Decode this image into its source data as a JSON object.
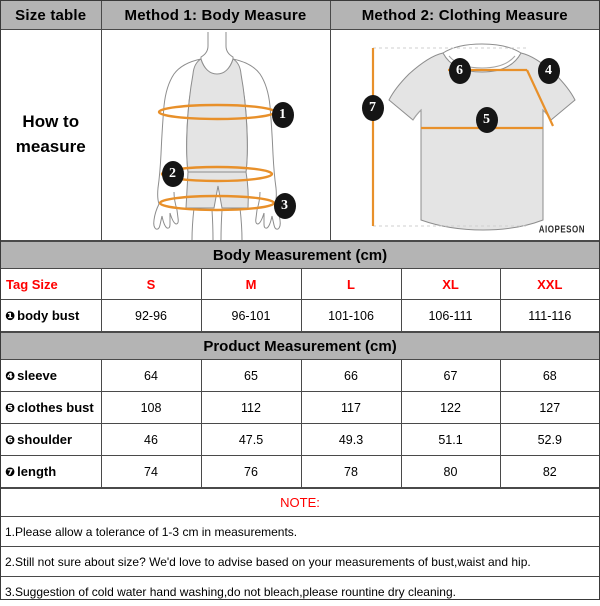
{
  "header": {
    "size_table": "Size table",
    "method1": "Method 1: Body  Measure",
    "method2": "Method 2: Clothing Measure"
  },
  "howto": {
    "line1": "How to",
    "line2": "measure"
  },
  "figures": {
    "body": {
      "callouts": [
        {
          "n": "1",
          "meaning": "body-bust"
        },
        {
          "n": "2",
          "meaning": "waist"
        },
        {
          "n": "3",
          "meaning": "hip"
        }
      ]
    },
    "clothing": {
      "callouts": [
        {
          "n": "4",
          "meaning": "sleeve"
        },
        {
          "n": "5",
          "meaning": "clothes-bust"
        },
        {
          "n": "6",
          "meaning": "shoulder"
        },
        {
          "n": "7",
          "meaning": "length"
        }
      ],
      "watermark": "AIOPESON"
    },
    "colors": {
      "measure_line": "#e8902a",
      "garment_fill": "#e4e4e4",
      "garment_stroke": "#8d8d8d",
      "callout_bg": "#151515"
    }
  },
  "body_section": {
    "title": "Body Measurement (cm)",
    "columns": [
      "Tag Size",
      "S",
      "M",
      "L",
      "XL",
      "XXL"
    ],
    "rows": [
      {
        "bullet": "❶",
        "label": "body bust",
        "values": [
          "92-96",
          "96-101",
          "101-106",
          "106-111",
          "111-116"
        ]
      }
    ]
  },
  "product_section": {
    "title": "Product Measurement (cm)",
    "rows": [
      {
        "bullet": "❹",
        "label": "sleeve",
        "values": [
          "64",
          "65",
          "66",
          "67",
          "68"
        ]
      },
      {
        "bullet": "❺",
        "label": "clothes bust",
        "values": [
          "108",
          "112",
          "117",
          "122",
          "127"
        ]
      },
      {
        "bullet": "❻",
        "label": "shoulder",
        "values": [
          "46",
          "47.5",
          "49.3",
          "51.1",
          "52.9"
        ]
      },
      {
        "bullet": "❼",
        "label": "length",
        "values": [
          "74",
          "76",
          "78",
          "80",
          "82"
        ]
      }
    ]
  },
  "note": {
    "title": "NOTE:",
    "lines": [
      "1.Please allow a tolerance of 1-3 cm in measurements.",
      "2.Still not sure about size? We'd love to advise based on your measurements of bust,waist and hip.",
      "3.Suggestion of cold water hand washing,do not bleach,please rountine dry cleaning."
    ]
  },
  "theme": {
    "band_gray": "#b4b4b4",
    "accent_red": "#ff0000",
    "border": "#4a4a4a"
  }
}
